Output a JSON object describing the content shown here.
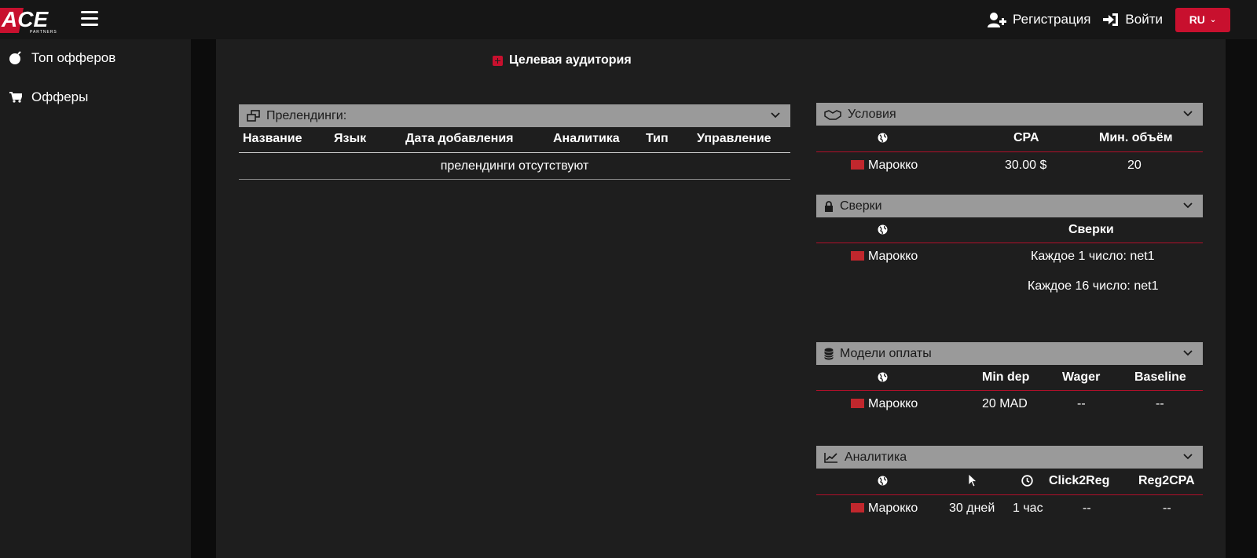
{
  "brand": {
    "logo_text": "ACE",
    "logo_sub": "PARTNERS",
    "accent": "#c8102e"
  },
  "topbar": {
    "register_label": "Регистрация",
    "login_label": "Войти",
    "lang": "RU"
  },
  "sidebar": {
    "items": [
      {
        "label": "Топ офферов",
        "icon": "bomb-icon"
      },
      {
        "label": "Офферы",
        "icon": "cart-icon"
      }
    ]
  },
  "audience": {
    "label": "Целевая аудитория"
  },
  "prelandings": {
    "title": "Прелендинги:",
    "columns": [
      "Название",
      "Язык",
      "Дата добавления",
      "Аналитика",
      "Тип",
      "Управление"
    ],
    "empty_text": "прелендинги отсутствуют"
  },
  "conditions": {
    "title": "Условия",
    "columns": [
      "CPA",
      "Мин. объём"
    ],
    "rows": [
      {
        "country": "Марокко",
        "cpa": "30.00 $",
        "min_volume": "20"
      }
    ]
  },
  "reconciliation": {
    "title": "Сверки",
    "column": "Сверки",
    "rows": [
      {
        "country": "Марокко",
        "lines": [
          "Каждое 1 число: net1",
          "Каждое 16 число: net1"
        ]
      }
    ]
  },
  "payment_models": {
    "title": "Модели оплаты",
    "columns": [
      "Min dep",
      "Wager",
      "Baseline"
    ],
    "rows": [
      {
        "country": "Марокко",
        "min_dep": "20 MAD",
        "wager": "--",
        "baseline": "--"
      }
    ]
  },
  "analytics": {
    "title": "Аналитика",
    "columns": [
      "Click2Reg",
      "Reg2CPA"
    ],
    "rows": [
      {
        "country": "Марокко",
        "period": "30 дней",
        "time": "1 час",
        "click2reg": "--",
        "reg2cpa": "--"
      }
    ]
  }
}
